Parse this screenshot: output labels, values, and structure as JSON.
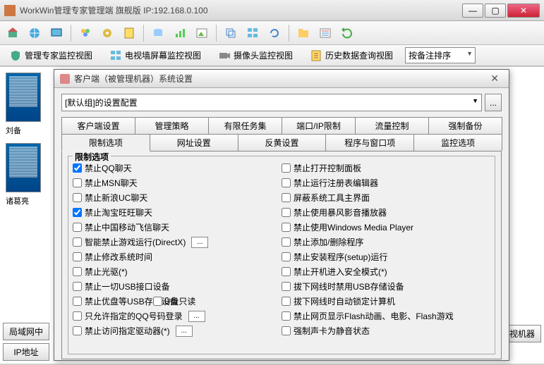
{
  "window": {
    "title": "WorkWin管理专家管理端    旗舰版 IP:192.168.0.100"
  },
  "viewbar": {
    "v1": "管理专家监控视图",
    "v2": "电视墙屏幕监控视图",
    "v3": "摄像头监控视图",
    "v4": "历史数据查询视图",
    "sort": "按备注排序"
  },
  "thumbs": {
    "t1": "刘备",
    "t2": "诸葛亮"
  },
  "bottom": {
    "b1": "局域网中",
    "b2": "IP地址",
    "b3": "监视机器"
  },
  "dialog": {
    "title": "客户端（被管理机器）系统设置",
    "combo": "[默认组]的设置配置",
    "browse": "...",
    "tabs1": {
      "t1": "客户端设置",
      "t2": "管理策略",
      "t3": "有限任务集",
      "t4": "端口/IP限制",
      "t5": "流量控制",
      "t6": "强制备份"
    },
    "tabs2": {
      "t1": "限制选项",
      "t2": "网址设置",
      "t3": "反黄设置",
      "t4": "程序与窗口项",
      "t5": "监控选项"
    },
    "legend": "限制选项",
    "left": [
      {
        "label": "禁止QQ聊天",
        "checked": true
      },
      {
        "label": "禁止MSN聊天",
        "checked": false
      },
      {
        "label": "禁止新浪UC聊天",
        "checked": false
      },
      {
        "label": "禁止淘宝旺旺聊天",
        "checked": true
      },
      {
        "label": "禁止中国移动飞信聊天",
        "checked": false
      },
      {
        "label": "智能禁止游戏运行(DirectX)",
        "checked": false,
        "extra": true
      },
      {
        "label": "禁止修改系统时间",
        "checked": false
      },
      {
        "label": "禁止光驱(*)",
        "checked": false
      },
      {
        "label": "禁止一切USB接口设备",
        "checked": false
      },
      {
        "label": "禁止优盘等USB存储设备",
        "checked": false,
        "mid": "U盘只读"
      },
      {
        "label": "只允许指定的QQ号码登录",
        "checked": false,
        "extra": true
      },
      {
        "label": "禁止访问指定驱动器(*)",
        "checked": false,
        "extra": true
      }
    ],
    "right": [
      {
        "label": "禁止打开控制面板",
        "checked": false
      },
      {
        "label": "禁止运行注册表编辑器",
        "checked": false
      },
      {
        "label": "屏蔽系统工具主界面",
        "checked": false
      },
      {
        "label": "禁止使用暴风影音播放器",
        "checked": false
      },
      {
        "label": "禁止使用Windows Media Player",
        "checked": false
      },
      {
        "label": "禁止添加/删除程序",
        "checked": false
      },
      {
        "label": "禁止安装程序(setup)运行",
        "checked": false
      },
      {
        "label": "禁止开机进入安全模式(*)",
        "checked": false
      },
      {
        "label": "拔下网线时禁用USB存储设备",
        "checked": false
      },
      {
        "label": "拔下网线时自动锁定计算机",
        "checked": false
      },
      {
        "label": "禁止网页显示Flash动画、电影、Flash游戏",
        "checked": false
      },
      {
        "label": "强制声卡为静音状态",
        "checked": false
      }
    ]
  }
}
